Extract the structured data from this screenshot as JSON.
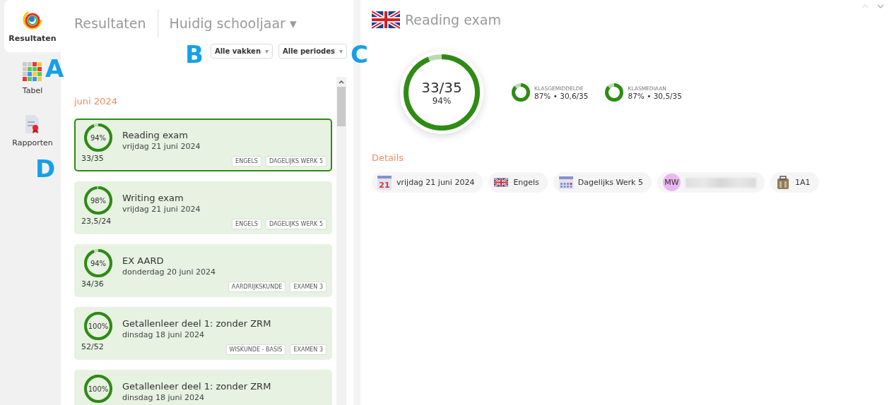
{
  "sidebar": {
    "items": [
      {
        "kind": "logo",
        "label": "Resultaten",
        "selected": true
      },
      {
        "kind": "grid",
        "label": "Tabel",
        "selected": false
      },
      {
        "kind": "report",
        "label": "Rapporten",
        "selected": false
      }
    ]
  },
  "header": {
    "title": "Resultaten",
    "period": "Huidig schooljaar",
    "caret": "▾"
  },
  "filters": [
    {
      "label": "Alle vakken",
      "caret": "▾"
    },
    {
      "label": "Alle periodes",
      "caret": "▾"
    }
  ],
  "month": "juni 2024",
  "results": [
    {
      "title": "Reading exam",
      "date": "vrijdag 21 juni 2024",
      "score": "33/35",
      "percent": "94%",
      "level": 0.94,
      "tags": [
        "ENGELS",
        "DAGELIJKS WERK 5"
      ],
      "selected": true
    },
    {
      "title": "Writing exam",
      "date": "vrijdag 21 juni 2024",
      "score": "23,5/24",
      "percent": "98%",
      "level": 0.98,
      "tags": [
        "ENGELS",
        "DAGELIJKS WERK 5"
      ],
      "selected": false
    },
    {
      "title": "EX AARD",
      "date": "donderdag 20 juni 2024",
      "score": "34/36",
      "percent": "94%",
      "level": 0.94,
      "tags": [
        "AARDRIJKSKUNDE",
        "EXAMEN 3"
      ],
      "selected": false
    },
    {
      "title": "Getallenleer deel 1: zonder ZRM",
      "date": "dinsdag 18 juni 2024",
      "score": "52/52",
      "percent": "100%",
      "level": 1,
      "tags": [
        "WISKUNDE - BASIS",
        "EXAMEN 3"
      ],
      "selected": false
    },
    {
      "title": "Getallenleer deel 1: zonder ZRM",
      "date": "dinsdag 18 juni 2024",
      "percent": "100%",
      "level": 1,
      "selected": false
    }
  ],
  "detail": {
    "title": "Reading exam",
    "score": "33/35",
    "percent": "94%",
    "level": 0.94,
    "stats": [
      {
        "label": "KLASGEMIDDELDE",
        "value": "87% • 30,6/35",
        "level": 0.87
      },
      {
        "label": "KLASMEDIAAN",
        "value": "87% • 30,5/35",
        "level": 0.87
      }
    ],
    "details_heading": "Details",
    "chips": [
      {
        "kind": "date",
        "icon_text": "21",
        "label": "vrijdag 21 juni 2024"
      },
      {
        "kind": "flag",
        "label": "Engels"
      },
      {
        "kind": "period",
        "label": "Dagelijks Werk 5"
      },
      {
        "kind": "teacher",
        "initials": "MW"
      },
      {
        "kind": "class",
        "label": "1A1"
      }
    ]
  },
  "annotations": [
    {
      "label": "A",
      "kind": "a"
    },
    {
      "label": "B",
      "kind": "b"
    },
    {
      "label": "C",
      "kind": "c"
    },
    {
      "label": "D",
      "kind": "d"
    }
  ]
}
